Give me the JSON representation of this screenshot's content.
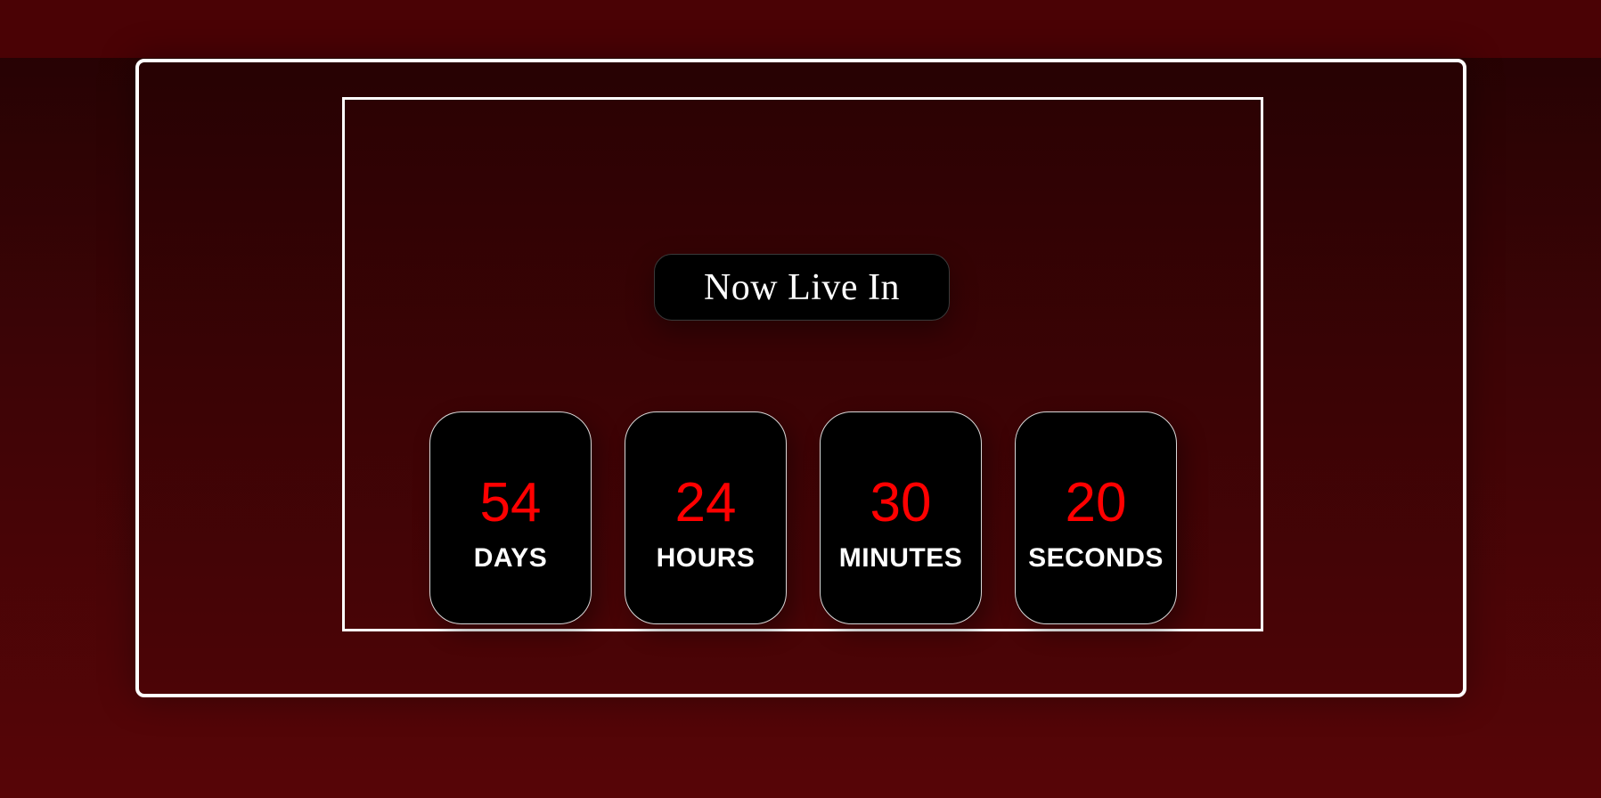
{
  "colors": {
    "background_top": "#230203",
    "background_bottom": "#570507",
    "top_band": "#4a0205",
    "frame_border": "#ffffff",
    "card_background": "#000000",
    "number_color": "#ff0000",
    "label_color": "#ffffff"
  },
  "banner": {
    "title": "Now Live In"
  },
  "countdown": {
    "units": [
      {
        "value": "54",
        "label": "DAYS"
      },
      {
        "value": "24",
        "label": "HOURS"
      },
      {
        "value": "30",
        "label": "MINUTES"
      },
      {
        "value": "20",
        "label": "SECONDS"
      }
    ]
  }
}
